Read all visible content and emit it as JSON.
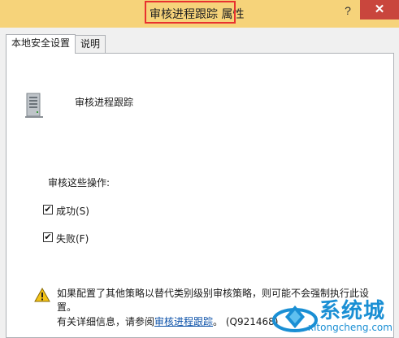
{
  "window": {
    "title": "审核进程跟踪 属性",
    "help_glyph": "?",
    "close_glyph": "✕"
  },
  "tabs": [
    {
      "label": "本地安全设置",
      "active": true
    },
    {
      "label": "说明",
      "active": false
    }
  ],
  "policy": {
    "name": "审核进程跟踪"
  },
  "audit": {
    "section_label": "审核这些操作:",
    "success": {
      "label": "成功(S)",
      "checked": true
    },
    "failure": {
      "label": "失败(F)",
      "checked": true
    }
  },
  "warning": {
    "text": "如果配置了其他策略以替代类别级别审核策略，则可能不会强制执行此设置。",
    "more_prefix": "有关详细信息，请参阅",
    "link_text": "审核进程跟踪",
    "more_suffix": "。 (Q921468)"
  },
  "watermark": {
    "brand": "系统城",
    "domain": "xitongcheng.com"
  },
  "colors": {
    "titlebar": "#f6d37a",
    "close_button": "#c9463d",
    "highlight_box": "#e8312f",
    "link": "#0a50a8",
    "watermark": "#1a8fd4"
  },
  "icons": [
    "policy-server-icon",
    "warning-icon",
    "help-icon",
    "close-icon",
    "checkmark-icon",
    "watermark-globe-icon"
  ]
}
